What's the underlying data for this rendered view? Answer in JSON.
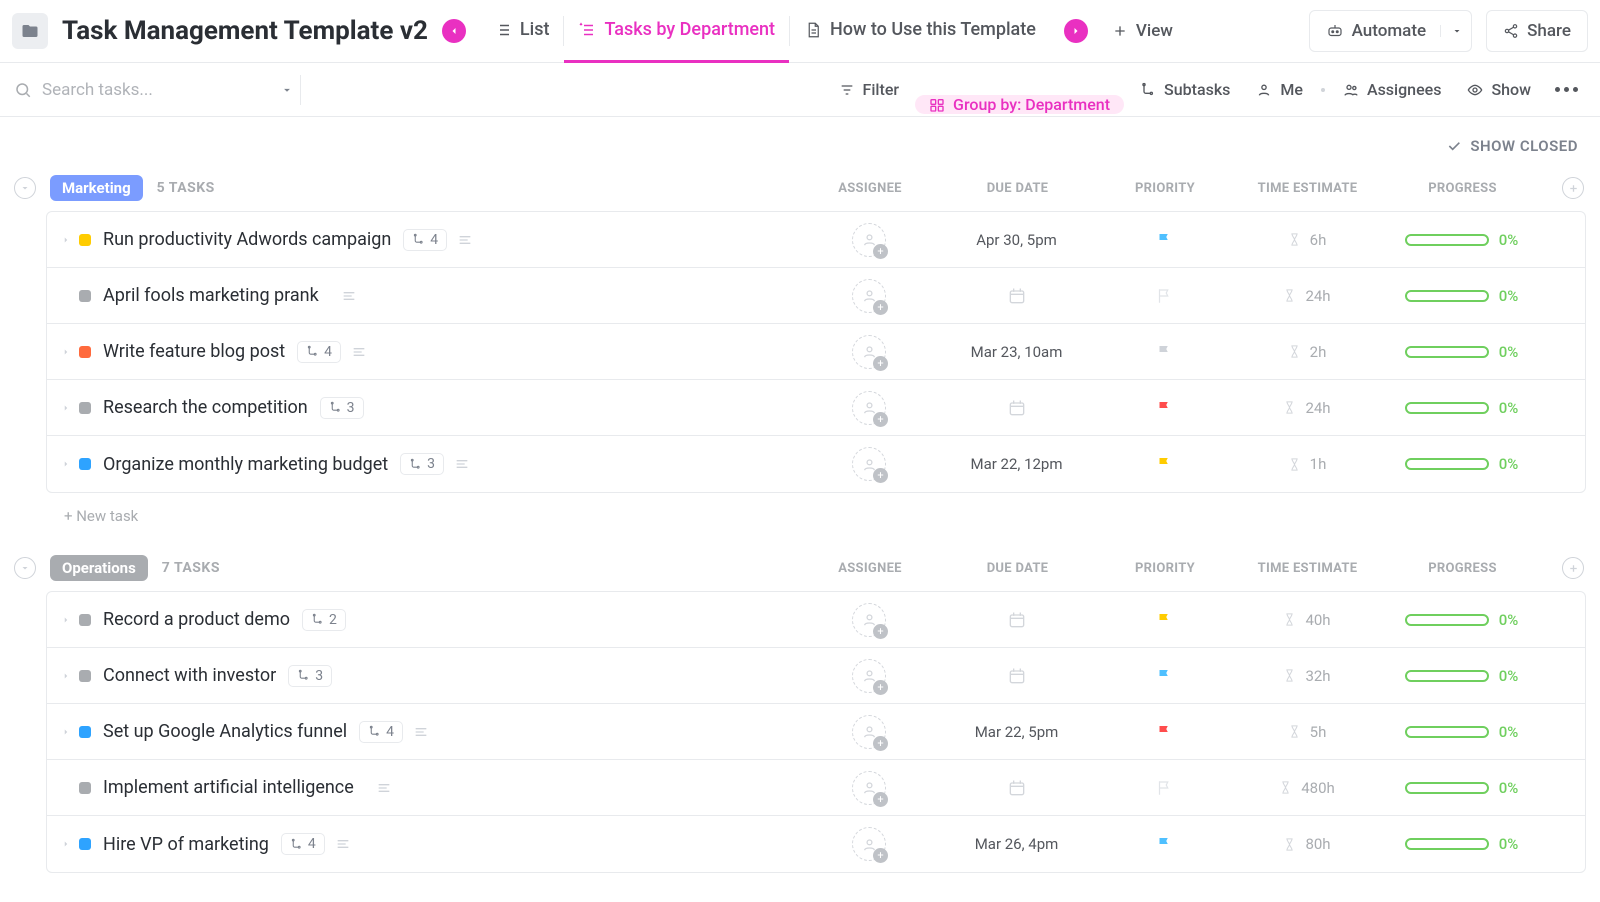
{
  "header": {
    "title": "Task Management Template v2",
    "views": [
      {
        "label": "List",
        "active": false
      },
      {
        "label": "Tasks by Department",
        "active": true
      },
      {
        "label": "How to Use this Template",
        "active": false
      }
    ],
    "add_view": "View",
    "automate": "Automate",
    "share": "Share"
  },
  "filterbar": {
    "search_placeholder": "Search tasks...",
    "filter": "Filter",
    "group_by": "Group by: Department",
    "subtasks": "Subtasks",
    "me": "Me",
    "assignees": "Assignees",
    "show": "Show"
  },
  "show_closed": "SHOW CLOSED",
  "columns": {
    "assignee": "ASSIGNEE",
    "due": "DUE DATE",
    "priority": "PRIORITY",
    "time": "TIME ESTIMATE",
    "progress": "PROGRESS"
  },
  "new_task": "+ New task",
  "groups": [
    {
      "name": "Marketing",
      "badge_class": "marketing",
      "task_count": "5 TASKS",
      "tasks": [
        {
          "expand": true,
          "status": "#ffcc00",
          "name": "Run productivity Adwords campaign",
          "subtasks": "4",
          "desc": true,
          "due": "Apr 30, 5pm",
          "flag": "blue",
          "time": "6h",
          "progress": "0%"
        },
        {
          "expand": false,
          "status": "#a9acb0",
          "name": "April fools marketing prank",
          "subtasks": "",
          "desc": true,
          "due": "",
          "flag": "none",
          "time": "24h",
          "progress": "0%"
        },
        {
          "expand": true,
          "status": "#ff6a3d",
          "name": "Write feature blog post",
          "subtasks": "4",
          "desc": true,
          "due": "Mar 23, 10am",
          "flag": "grey",
          "time": "2h",
          "progress": "0%"
        },
        {
          "expand": true,
          "status": "#a9acb0",
          "name": "Research the competition",
          "subtasks": "3",
          "desc": false,
          "due": "",
          "flag": "red",
          "time": "24h",
          "progress": "0%"
        },
        {
          "expand": true,
          "status": "#2ea3ff",
          "name": "Organize monthly marketing budget",
          "subtasks": "3",
          "desc": true,
          "due": "Mar 22, 12pm",
          "flag": "yellow",
          "time": "1h",
          "progress": "0%"
        }
      ]
    },
    {
      "name": "Operations",
      "badge_class": "operations",
      "task_count": "7 TASKS",
      "tasks": [
        {
          "expand": true,
          "status": "#a9acb0",
          "name": "Record a product demo",
          "subtasks": "2",
          "desc": false,
          "due": "",
          "flag": "yellow",
          "time": "40h",
          "progress": "0%"
        },
        {
          "expand": true,
          "status": "#a9acb0",
          "name": "Connect with investor",
          "subtasks": "3",
          "desc": false,
          "due": "",
          "flag": "blue",
          "time": "32h",
          "progress": "0%"
        },
        {
          "expand": true,
          "status": "#2ea3ff",
          "name": "Set up Google Analytics funnel",
          "subtasks": "4",
          "desc": true,
          "due": "Mar 22, 5pm",
          "flag": "red",
          "time": "5h",
          "progress": "0%"
        },
        {
          "expand": false,
          "status": "#a9acb0",
          "name": "Implement artificial intelligence",
          "subtasks": "",
          "desc": true,
          "due": "",
          "flag": "none",
          "time": "480h",
          "progress": "0%"
        },
        {
          "expand": true,
          "status": "#2ea3ff",
          "name": "Hire VP of marketing",
          "subtasks": "4",
          "desc": true,
          "due": "Mar 26, 4pm",
          "flag": "blue",
          "time": "80h",
          "progress": "0%"
        }
      ]
    }
  ]
}
